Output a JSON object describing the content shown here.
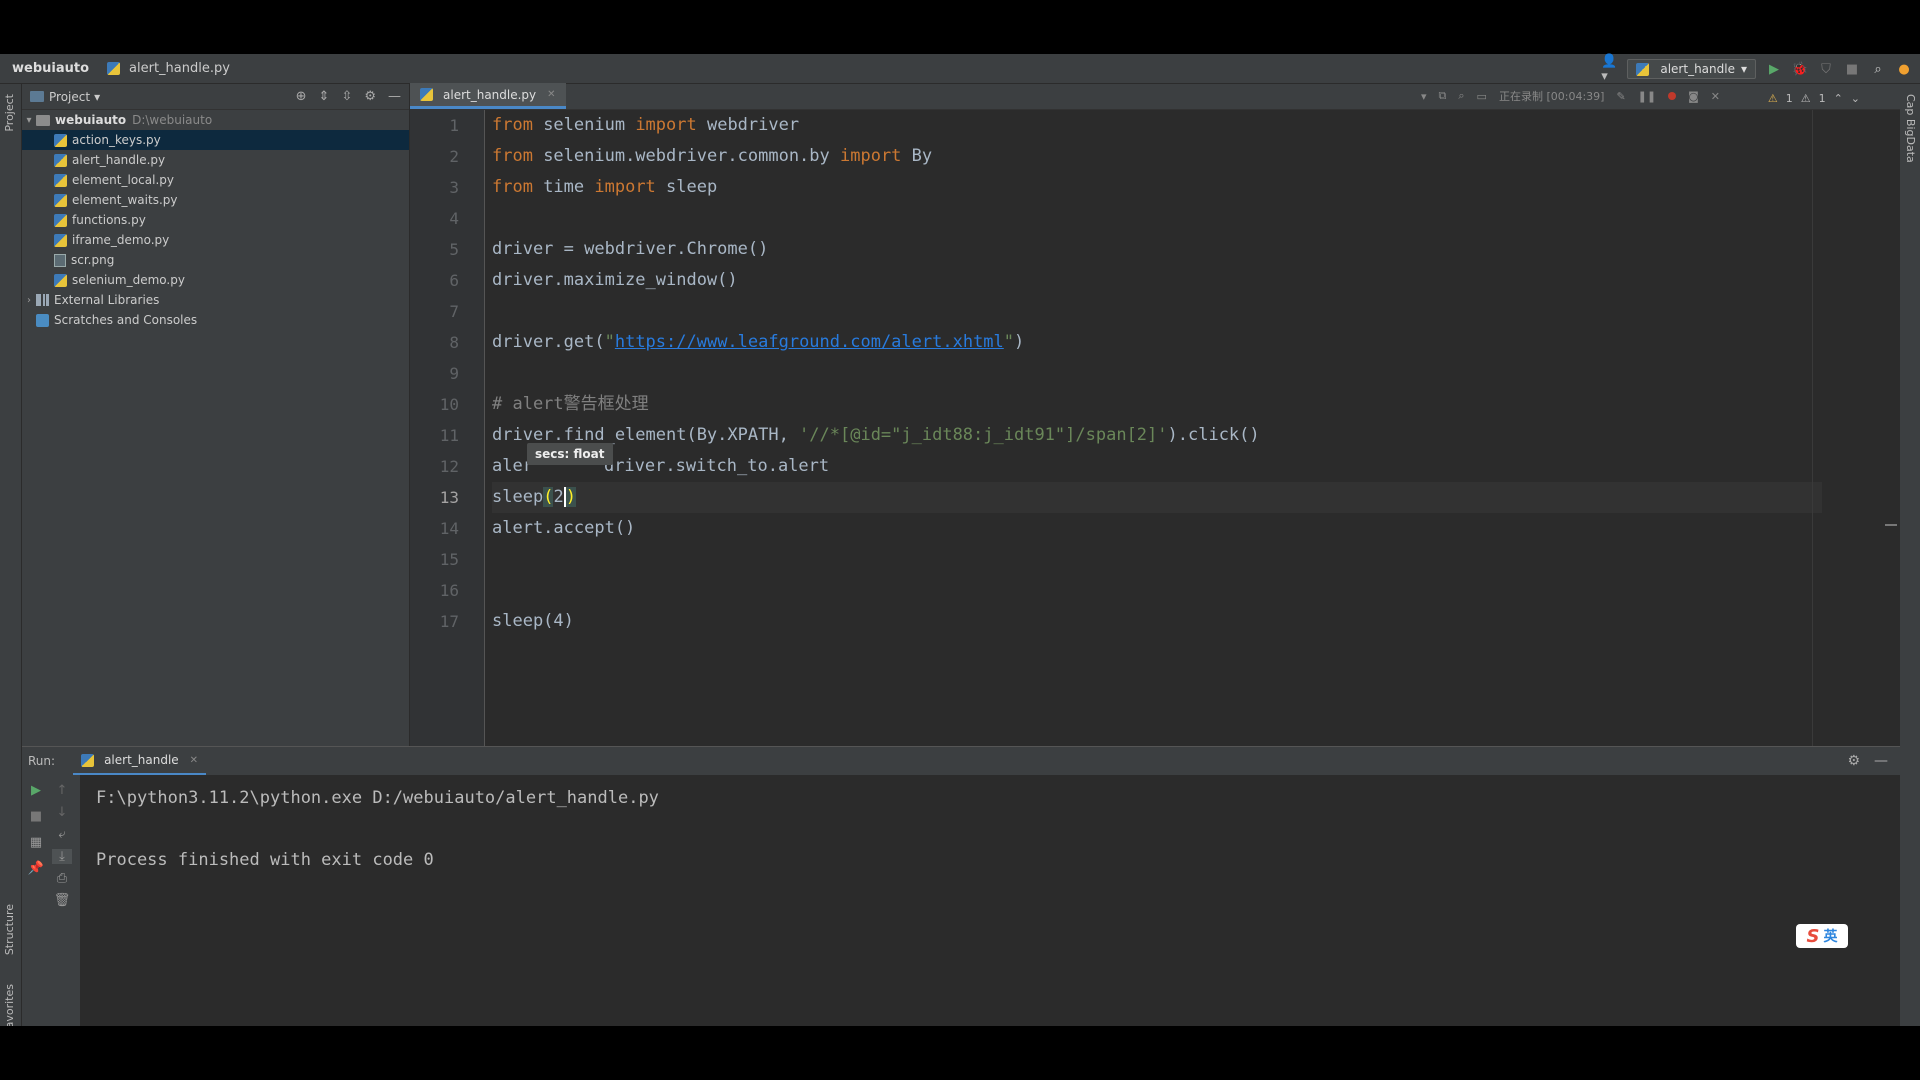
{
  "titlebar": {
    "project_name": "webuiauto",
    "current_file": "alert_handle.py",
    "run_config": "alert_handle"
  },
  "project_panel": {
    "title": "Project",
    "root": {
      "name": "webuiauto",
      "path": "D:\\webuiauto"
    },
    "files": [
      "action_keys.py",
      "alert_handle.py",
      "element_local.py",
      "element_waits.py",
      "functions.py",
      "iframe_demo.py",
      "scr.png",
      "selenium_demo.py"
    ],
    "external_libraries": "External Libraries",
    "scratches": "Scratches and Consoles"
  },
  "editor": {
    "tab_label": "alert_handle.py",
    "recording": "正在录制 [00:04:39]",
    "inspections": {
      "warnings": "1",
      "weak_warnings": "1"
    },
    "line_numbers": [
      "1",
      "2",
      "3",
      "4",
      "5",
      "6",
      "7",
      "8",
      "9",
      "10",
      "11",
      "12",
      "13",
      "14",
      "15",
      "16",
      "17"
    ],
    "current_line": 13,
    "tooltip": "secs: float",
    "code": {
      "l1_kw1": "from",
      "l1_mid": " selenium ",
      "l1_kw2": "import",
      "l1_end": " webdriver",
      "l2_kw1": "from",
      "l2_mid": " selenium.webdriver.common.by ",
      "l2_kw2": "import",
      "l2_end": " By",
      "l3_kw1": "from",
      "l3_mid": " time ",
      "l3_kw2": "import",
      "l3_end": " sleep",
      "l5": "driver = webdriver.Chrome()",
      "l6": "driver.maximize_window()",
      "l8_pre": "driver.get(",
      "l8_q1": "\"",
      "l8_url": "https://www.leafground.com/alert.xhtml",
      "l8_q2": "\"",
      "l8_post": ")",
      "l10": "# alert警告框处理",
      "l11_pre": "driver.find_element(By.XPATH, ",
      "l11_str": "'//*[@id=\"j_idt88:j_idt91\"]/span[2]'",
      "l11_post": ").click()",
      "l12_a": "aler",
      "l12_b": "driver.switch_to.alert",
      "l13_pre": "sleep",
      "l13_open": "(",
      "l13_arg": "2",
      "l13_close": ")",
      "l14": "alert.accept()",
      "l17": "sleep(4)"
    }
  },
  "run_panel": {
    "label": "Run:",
    "tab": "alert_handle",
    "output_line1": "F:\\python3.11.2\\python.exe D:/webuiauto/alert_handle.py",
    "output_line2": "Process finished with exit code 0"
  },
  "side_labels": {
    "project": "Project",
    "structure": "Structure",
    "favorites": "Favorites",
    "right": "Cap BigData"
  },
  "ime": {
    "s": "S",
    "lang": "英"
  }
}
